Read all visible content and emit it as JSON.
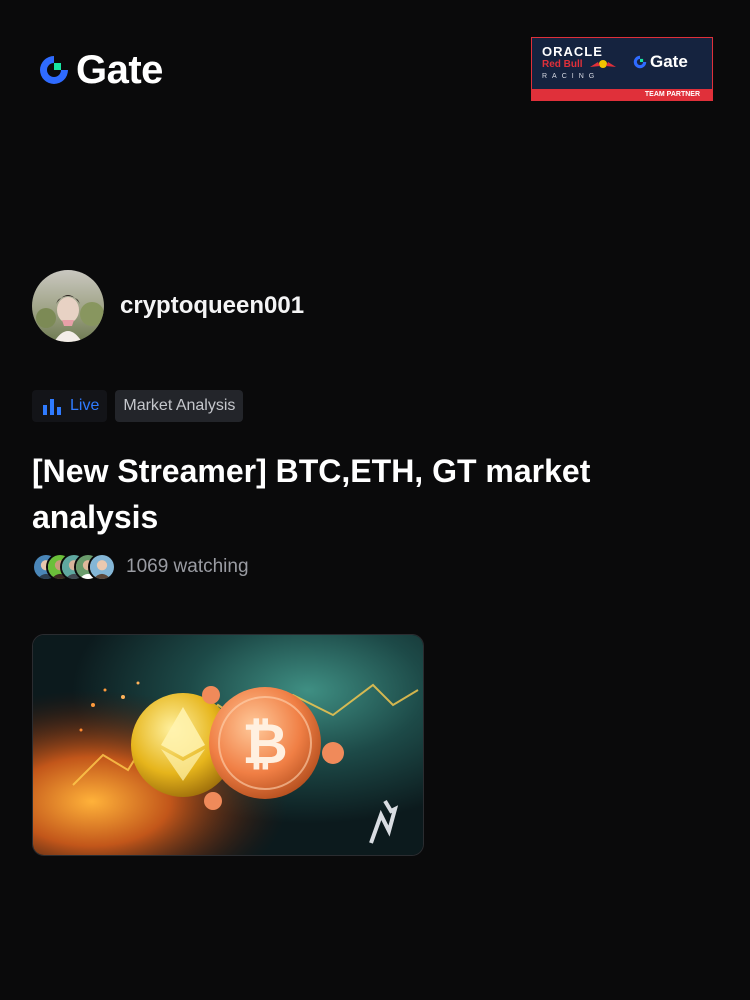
{
  "brand": {
    "name": "Gate"
  },
  "partner": {
    "line1": "ORACLE",
    "line2": "Red Bull",
    "line3": "RACING",
    "gate": "Gate",
    "badge": "TEAM PARTNER"
  },
  "streamer": {
    "username": "cryptoqueen001"
  },
  "tags": {
    "live": "Live",
    "category": "Market Analysis"
  },
  "stream": {
    "title": "[New Streamer] BTC,ETH, GT market analysis",
    "watching": "1069 watching"
  },
  "icons": [
    "gate-logo-icon",
    "live-bars-icon",
    "bitcoin-icon",
    "ethereum-icon"
  ],
  "colors": {
    "background": "#0a0a0b",
    "accent": "#2f7bff",
    "brand_green": "#17e5a3",
    "partner_red": "#e0303a"
  }
}
